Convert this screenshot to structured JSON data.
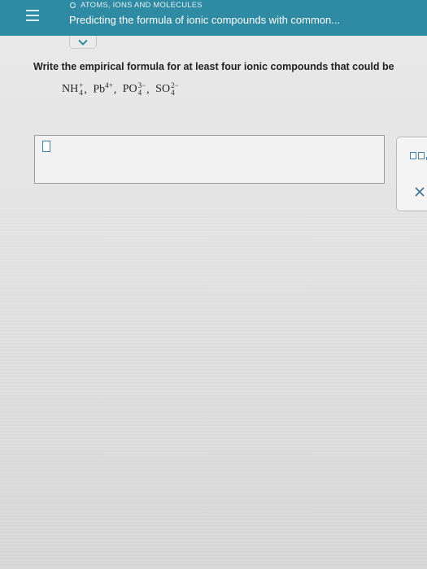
{
  "header": {
    "topic": "ATOMS, IONS AND MOLECULES",
    "title": "Predicting the formula of ionic compounds with common..."
  },
  "question": {
    "prompt": "Write the empirical formula for at least four ionic compounds that could be",
    "ions": [
      {
        "base": "NH",
        "sub": "4",
        "charge": "+"
      },
      {
        "base": "Pb",
        "sub": "",
        "charge": "4+"
      },
      {
        "base": "PO",
        "sub": "4",
        "charge": "3−"
      },
      {
        "base": "SO",
        "sub": "4",
        "charge": "2−"
      }
    ],
    "separator": ","
  },
  "answer": {
    "value": ""
  },
  "icons": {
    "menu": "hamburger-menu-icon",
    "topic_marker": "circle-icon",
    "expand": "chevron-down-icon",
    "template": "subscript-superscript-boxes-icon",
    "clear": "close-icon"
  },
  "colors": {
    "header": "#2f8aa3",
    "accent": "#3b7fb0",
    "background": "#e6e6e6"
  }
}
